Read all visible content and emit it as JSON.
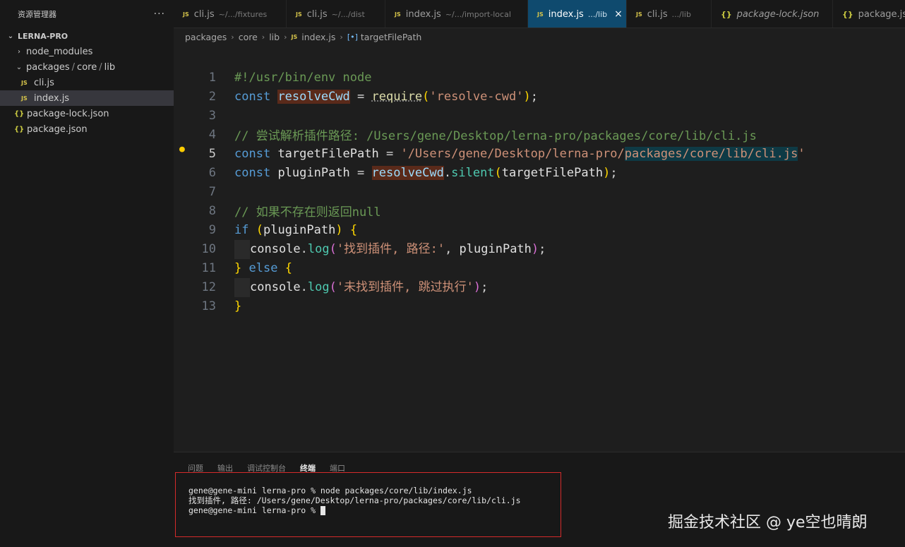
{
  "sidebar": {
    "title": "资源管理器",
    "more": "···",
    "project": "LERNA-PRO",
    "tree": {
      "node_modules": "node_modules",
      "packages_folder": [
        "packages",
        "core",
        "lib"
      ],
      "cli_js": "cli.js",
      "index_js": "index.js",
      "package_lock": "package-lock.json",
      "package_json": "package.json"
    }
  },
  "tabs": [
    {
      "label": "cli.js",
      "desc": "~/.../fixtures"
    },
    {
      "label": "cli.js",
      "desc": "~/.../dist"
    },
    {
      "label": "index.js",
      "desc": "~/.../import-local"
    },
    {
      "label": "index.js",
      "desc": ".../lib"
    },
    {
      "label": "cli.js",
      "desc": ".../lib"
    },
    {
      "label": "package-lock.json"
    },
    {
      "label": "package.json"
    }
  ],
  "breadcrumb": [
    "packages",
    "core",
    "lib",
    "index.js",
    "targetFilePath"
  ],
  "editor": {
    "line_numbers": [
      "1",
      "2",
      "3",
      "4",
      "5",
      "6",
      "7",
      "8",
      "9",
      "10",
      "11",
      "12",
      "13"
    ],
    "code": {
      "l1": "#!/usr/bin/env node",
      "l2_const": "const",
      "l2_name": "resolveCwd",
      "l2_eq": " = ",
      "l2_fn": "require",
      "l2_str": "'resolve-cwd'",
      "l4": "// 尝试解析插件路径: /Users/gene/Desktop/lerna-pro/packages/core/lib/cli.js",
      "l5_const": "const",
      "l5_name": "targetFilePath",
      "l5_eq": " = ",
      "l5_str_a": "'/Users/gene/Desktop/lerna-pro/",
      "l5_str_b": "packages/core/lib/cli.js",
      "l5_str_c": "'",
      "l6_const": "const",
      "l6_name": "pluginPath",
      "l6_eq": " = ",
      "l6_obj": "resolveCwd",
      "l6_method": "silent",
      "l6_arg": "targetFilePath",
      "l8": "// 如果不存在则返回null",
      "l9_kw": "if",
      "l9_arg": "pluginPath",
      "l10_obj": "console",
      "l10_fn": "log",
      "l10_str": "'找到插件, 路径:'",
      "l10_arg": "pluginPath",
      "l11_kw": "else",
      "l12_obj": "console",
      "l12_fn": "log",
      "l12_str": "'未找到插件, 跳过执行'"
    }
  },
  "panel": {
    "tabs": [
      "问题",
      "输出",
      "调试控制台",
      "终端",
      "端口"
    ],
    "terminal_lines": [
      "gene@gene-mini lerna-pro % node packages/core/lib/index.js",
      "找到插件, 路径: /Users/gene/Desktop/lerna-pro/packages/core/lib/cli.js",
      "gene@gene-mini lerna-pro % "
    ]
  },
  "watermark": "掘金技术社区 @ ye空也晴朗"
}
